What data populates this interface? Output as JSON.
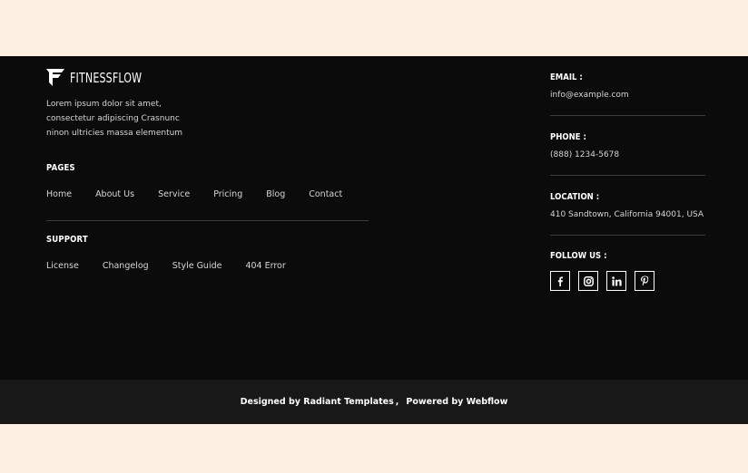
{
  "brand": {
    "name": "FITNESSFLOW"
  },
  "footer": {
    "description": "Lorem ipsum dolor sit amet, consectetur adipiscing Crasnunc ninon ultricies massa elementum",
    "pages": {
      "heading": "PAGES",
      "links": [
        "Home",
        "About Us",
        "Service",
        "Pricing",
        "Blog",
        "Contact"
      ]
    },
    "support": {
      "heading": "SUPPORT",
      "links": [
        "License",
        "Changelog",
        "Style Guide",
        "404 Error"
      ]
    },
    "contact": {
      "email_label": "EMAIL :",
      "email": "info@example.com",
      "phone_label": "PHONE :",
      "phone": "(888) 1234-5678",
      "location_label": "LOCATION :",
      "location": "410 Sandtown, California 94001, USA",
      "follow_label": "FOLLOW US :"
    },
    "social_icons": [
      "facebook-icon",
      "instagram-icon",
      "linkedin-icon",
      "pinterest-icon"
    ]
  },
  "copyright": {
    "designed_by": "Designed by Radiant Templates",
    "separator": ",",
    "powered_by": "Powered by Webflow"
  },
  "colors": {
    "page_bg": "#fdf0e2",
    "footer_bg": "#0b0b0b",
    "copyright_bg": "#181818",
    "text_primary": "#ffffff",
    "text_secondary": "#d6d6d6"
  }
}
